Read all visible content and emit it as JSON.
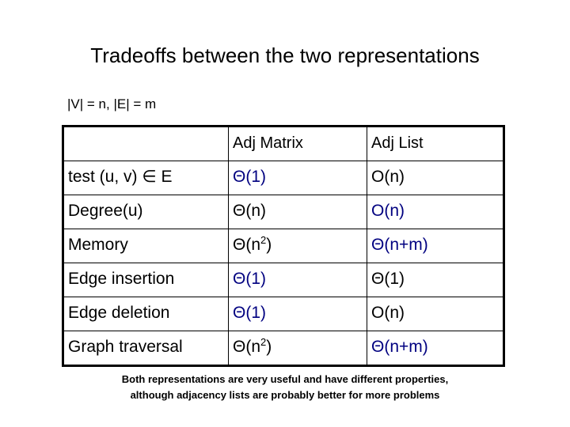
{
  "slide": {
    "title": "Tradeoffs between the two representations",
    "subtitle": "|V| = n, |E| = m",
    "caption_line1": "Both representations are very useful and have different properties,",
    "caption_line2": "although adjacency lists are probably better for more problems",
    "better_color": "#000080",
    "plain_color": "#000000",
    "background_color": "#ffffff"
  },
  "table": {
    "corner_header": "",
    "columns": [
      "",
      "Adj Matrix",
      "Adj List"
    ],
    "rows": [
      {
        "operation": "test (u, v) ∈ E",
        "adj_matrix": "Θ(1)",
        "adj_matrix_better": true,
        "adj_list": "O(n)",
        "adj_list_better": false
      },
      {
        "operation": "Degree(u)",
        "adj_matrix": "Θ(n)",
        "adj_matrix_better": false,
        "adj_list": "O(n)",
        "adj_list_better": true
      },
      {
        "operation": "Memory",
        "adj_matrix": "Θ(n²)",
        "adj_matrix_better": false,
        "adj_list": "Θ(n+m)",
        "adj_list_better": true
      },
      {
        "operation": "Edge insertion",
        "adj_matrix": "Θ(1)",
        "adj_matrix_better": true,
        "adj_list": "Θ(1)",
        "adj_list_better": false
      },
      {
        "operation": "Edge deletion",
        "adj_matrix": "Θ(1)",
        "adj_matrix_better": true,
        "adj_list": "O(n)",
        "adj_list_better": false
      },
      {
        "operation": "Graph traversal",
        "adj_matrix": "Θ(n²)",
        "adj_matrix_better": false,
        "adj_list": "Θ(n+m)",
        "adj_list_better": true
      }
    ]
  }
}
